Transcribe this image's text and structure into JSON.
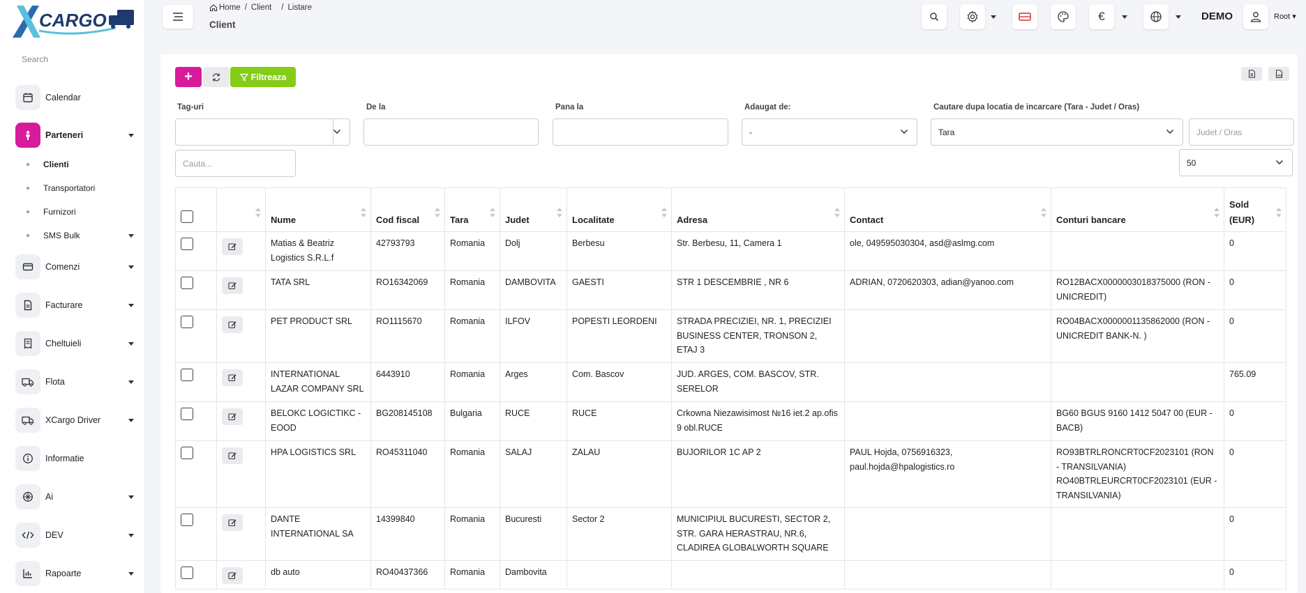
{
  "brand": {
    "logo_x": "X",
    "logo_text": "CARGO",
    "accent": "#d81b9b",
    "filter_green": "#84cc16"
  },
  "sidebar": {
    "search_placeholder": "Search",
    "items": [
      {
        "label": "Calendar",
        "icon": "calendar-icon"
      },
      {
        "label": "Parteneri",
        "icon": "person-icon",
        "active": true
      },
      {
        "label": "Comenzi",
        "icon": "card-icon"
      },
      {
        "label": "Facturare",
        "icon": "document-icon"
      },
      {
        "label": "Cheltuieli",
        "icon": "receipt-icon"
      },
      {
        "label": "Flota",
        "icon": "truck-icon"
      },
      {
        "label": "XCargo Driver",
        "icon": "truck-icon"
      },
      {
        "label": "Informatie",
        "icon": "info-icon"
      },
      {
        "label": "Ai",
        "icon": "ai-icon"
      },
      {
        "label": "DEV",
        "icon": "code-icon"
      },
      {
        "label": "Rapoarte",
        "icon": "chart-icon"
      }
    ],
    "subitems": [
      {
        "label": "Clienti",
        "active": true
      },
      {
        "label": "Transportatori"
      },
      {
        "label": "Furnizori"
      },
      {
        "label": "SMS Bulk"
      }
    ]
  },
  "header": {
    "breadcrumb": [
      "Home",
      "Client",
      "Listare"
    ],
    "title": "Client",
    "demo": "DEMO",
    "user": "Root"
  },
  "toolbar": {
    "add": "+",
    "filter": "Filtreaza"
  },
  "filters": {
    "tags_label": "Tag-uri",
    "from_label": "De la",
    "to_label": "Pana la",
    "added_by_label": "Adaugat de:",
    "added_by_value": "-",
    "location_label": "Cautare dupa locatia de incarcare (Tara - Judet / Oras)",
    "country_value": "Tara",
    "county_placeholder": "Judet / Oras",
    "search_placeholder": "Cauta...",
    "page_size": "50"
  },
  "table": {
    "headers": [
      "Nume",
      "Cod fiscal",
      "Tara",
      "Judet",
      "Localitate",
      "Adresa",
      "Contact",
      "Conturi bancare",
      "Sold (EUR)"
    ],
    "rows": [
      [
        "Matias & Beatriz Logistics S.R.L.f",
        "42793793",
        "Romania",
        "Dolj",
        "Berbesu",
        "Str. Berbesu, 11, Camera 1",
        "ole, 049595030304, asd@aslmg.com",
        "",
        "0"
      ],
      [
        "TATA SRL",
        "RO16342069",
        "Romania",
        "DAMBOVITA",
        "GAESTI",
        "STR 1 DESCEMBRIE , NR 6",
        "ADRIAN, 0720620303, adian@yanoo.com",
        "RO12BACX0000003018375000 (RON - UNICREDIT)",
        "0"
      ],
      [
        "PET PRODUCT SRL",
        "RO1115670",
        "Romania",
        "ILFOV",
        "POPESTI LEORDENI",
        "STRADA PRECIZIEI, NR. 1, PRECIZIEI BUSINESS CENTER, TRONSON 2, ETAJ 3",
        "",
        "RO04BACX0000001135862000 (RON - UNICREDIT BANK-N. )",
        "0"
      ],
      [
        "INTERNATIONAL LAZAR COMPANY SRL",
        "6443910",
        "Romania",
        "Arges",
        "Com. Bascov",
        "JUD. ARGES, COM. BASCOV, STR. SERELOR",
        "",
        "",
        "765.09"
      ],
      [
        "BELOKC LOGICTIKC - EOOD",
        "BG208145108",
        "Bulgaria",
        "RUCE",
        "RUCE",
        "Crkowna Niezawisimost №16 iet.2 ap.ofis 9 obl.RUCE",
        "",
        "BG60 BGUS 9160 1412 5047 00 (EUR - BACB)",
        "0"
      ],
      [
        "HPA LOGISTICS SRL",
        "RO45311040",
        "Romania",
        "SALAJ",
        "ZALAU",
        "BUJORILOR 1C AP 2",
        "PAUL Hojda, 0756916323, paul.hojda@hpalogistics.ro",
        "RO93BTRLRONCRT0CF2023101 (RON - TRANSILVANIA) RO40BTRLEURCRT0CF2023101 (EUR - TRANSILVANIA)",
        "0"
      ],
      [
        "DANTE INTERNATIONAL SA",
        "14399840",
        "Romania",
        "Bucuresti",
        "Sector 2",
        "MUNICIPIUL BUCURESTI, SECTOR 2, STR. GARA HERASTRAU, NR.6, CLADIREA GLOBALWORTH SQUARE",
        "",
        "",
        "0"
      ],
      [
        "db auto",
        "RO40437366",
        "Romania",
        "Dambovita",
        "",
        "",
        "",
        "",
        "0"
      ]
    ]
  }
}
